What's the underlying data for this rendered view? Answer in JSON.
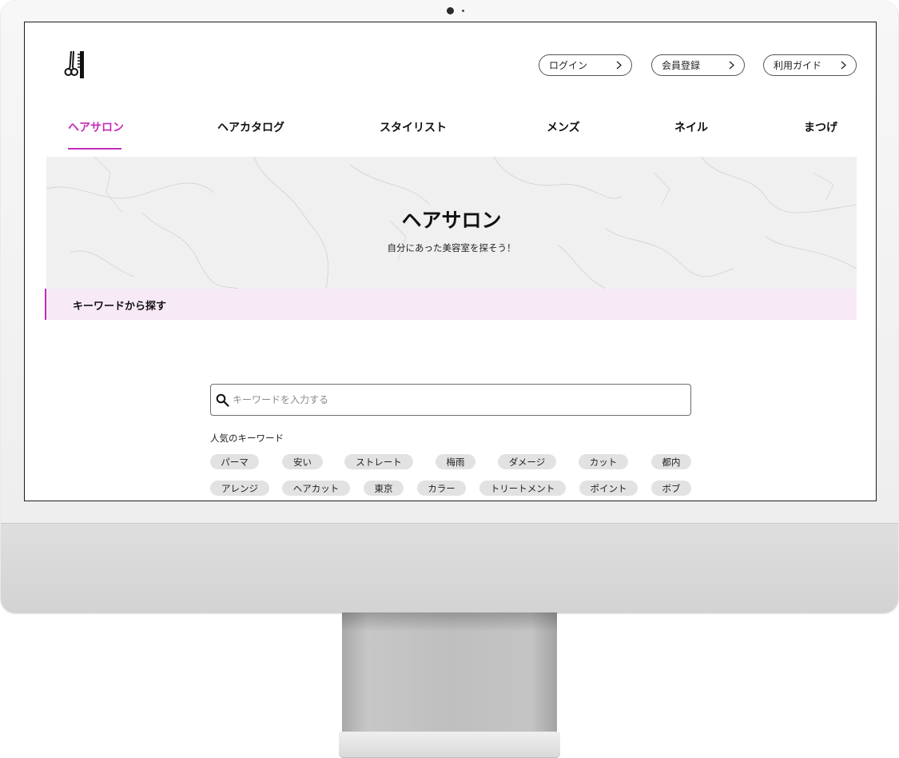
{
  "header": {
    "buttons": [
      {
        "label": "ログイン"
      },
      {
        "label": "会員登録"
      },
      {
        "label": "利用ガイド"
      }
    ]
  },
  "nav": {
    "tabs": [
      {
        "label": "ヘアサロン",
        "active": true
      },
      {
        "label": "ヘアカタログ"
      },
      {
        "label": "スタイリスト"
      },
      {
        "label": "メンズ"
      },
      {
        "label": "ネイル"
      },
      {
        "label": "まつげ"
      }
    ]
  },
  "hero": {
    "title": "ヘアサロン",
    "subtitle": "自分にあった美容室を探そう！"
  },
  "section": {
    "title": "キーワードから探す"
  },
  "search": {
    "placeholder": "キーワードを入力する"
  },
  "keywords": {
    "label": "人気のキーワード",
    "row1": [
      "パーマ",
      "安い",
      "ストレート",
      "梅雨",
      "ダメージ",
      "カット",
      "都内"
    ],
    "row2": [
      "アレンジ",
      "ヘアカット",
      "東京",
      "カラー",
      "トリートメント",
      "ポイント",
      "ボブ"
    ]
  },
  "colors": {
    "accent": "#c42bb9",
    "section_bg": "#f8e9f6",
    "chip_bg": "#e2e2e2"
  },
  "icons": {
    "logo": "scissors-comb-icon",
    "search": "search-icon",
    "chevron": "chevron-right-icon"
  }
}
